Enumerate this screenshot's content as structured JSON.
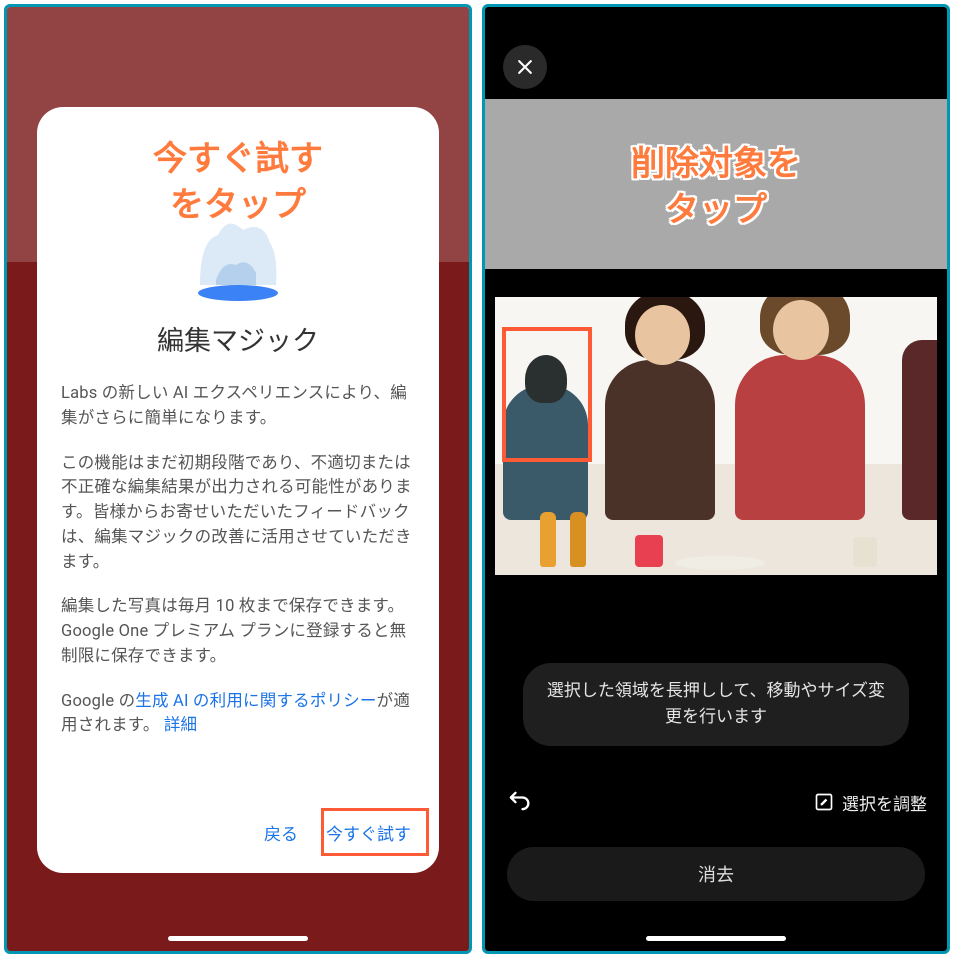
{
  "left": {
    "annotation_line1": "今すぐ試す",
    "annotation_line2": "をタップ",
    "modal_title": "編集マジック",
    "para1": "Labs の新しい AI エクスペリエンスにより、編集がさらに簡単になります。",
    "para2": "この機能はまだ初期段階であり、不適切または不正確な編集結果が出力される可能性があります。皆様からお寄せいただいたフィードバックは、編集マジックの改善に活用させていただきます。",
    "para3": "編集した写真は毎月 10 枚まで保存できます。Google One プレミアム プランに登録すると無制限に保存できます。",
    "para4_prefix": "Google の",
    "para4_link": "生成 AI の利用に関するポリシー",
    "para4_suffix": "が適用されます。",
    "para4_more": "詳細",
    "back_label": "戻る",
    "try_label": "今すぐ試す"
  },
  "right": {
    "annotation_line1": "削除対象を",
    "annotation_line2": "タップ",
    "hint_text": "選択した領域を長押しして、移動やサイズ変更を行います",
    "adjust_label": "選択を調整",
    "erase_label": "消去"
  }
}
